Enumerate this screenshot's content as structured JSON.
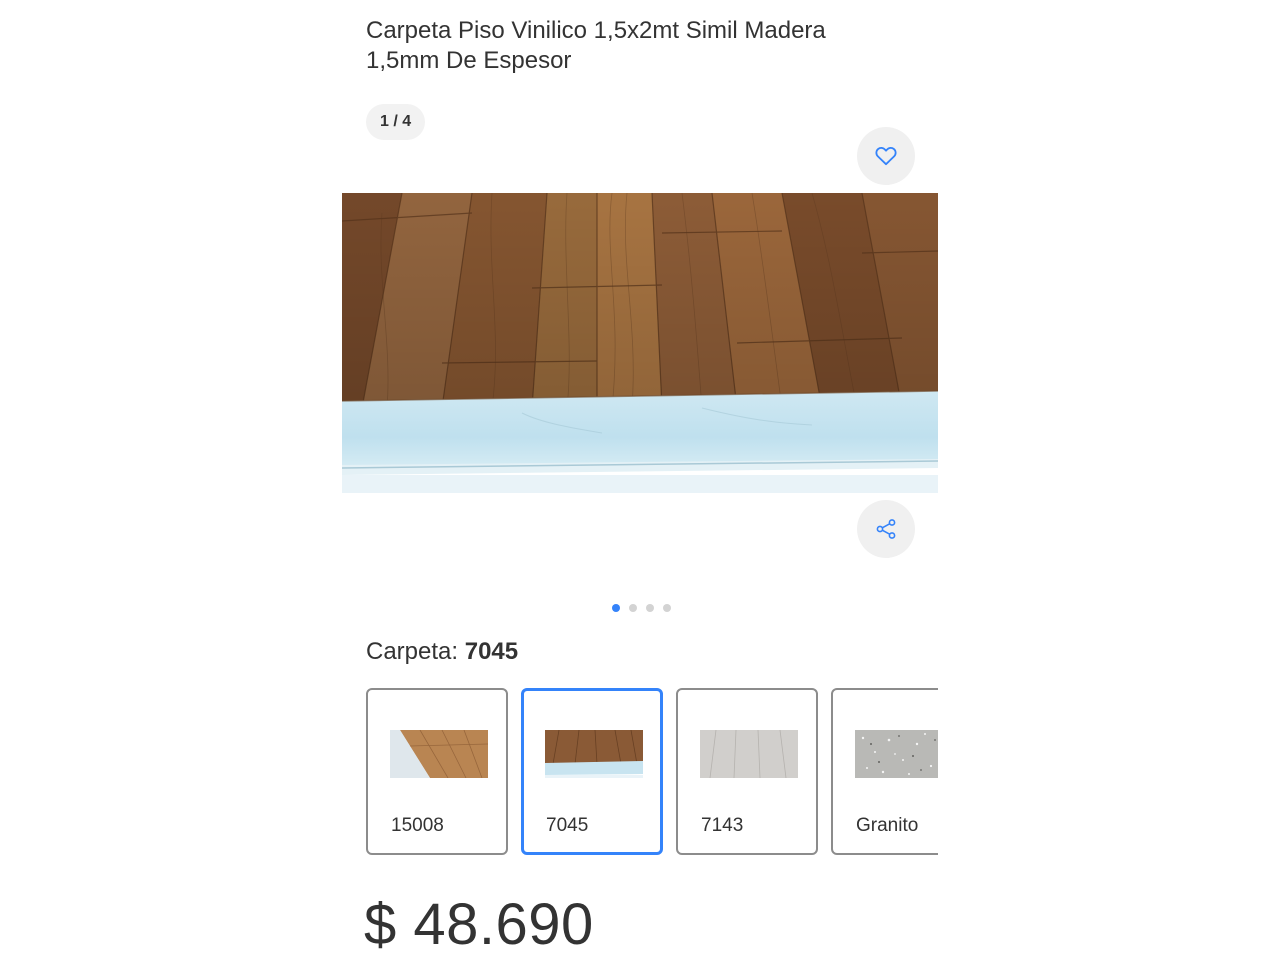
{
  "product": {
    "title": "Carpeta Piso Vinilico 1,5x2mt Simil Madera 1,5mm De Espesor",
    "image_counter": "1 / 4",
    "favorite_icon": "heart-icon",
    "share_icon": "share-icon",
    "carousel": {
      "total": 4,
      "active_index": 0
    }
  },
  "variant_selector": {
    "label": "Carpeta: ",
    "selected_value": "7045",
    "options": [
      {
        "name": "15008",
        "selected": false
      },
      {
        "name": "7045",
        "selected": true
      },
      {
        "name": "7143",
        "selected": false
      },
      {
        "name": "Granito",
        "selected": false
      }
    ]
  },
  "price": {
    "display": "$ 48.690"
  },
  "colors": {
    "accent": "#3483fa",
    "text": "#333333",
    "button_bg": "#f0f0f0"
  }
}
